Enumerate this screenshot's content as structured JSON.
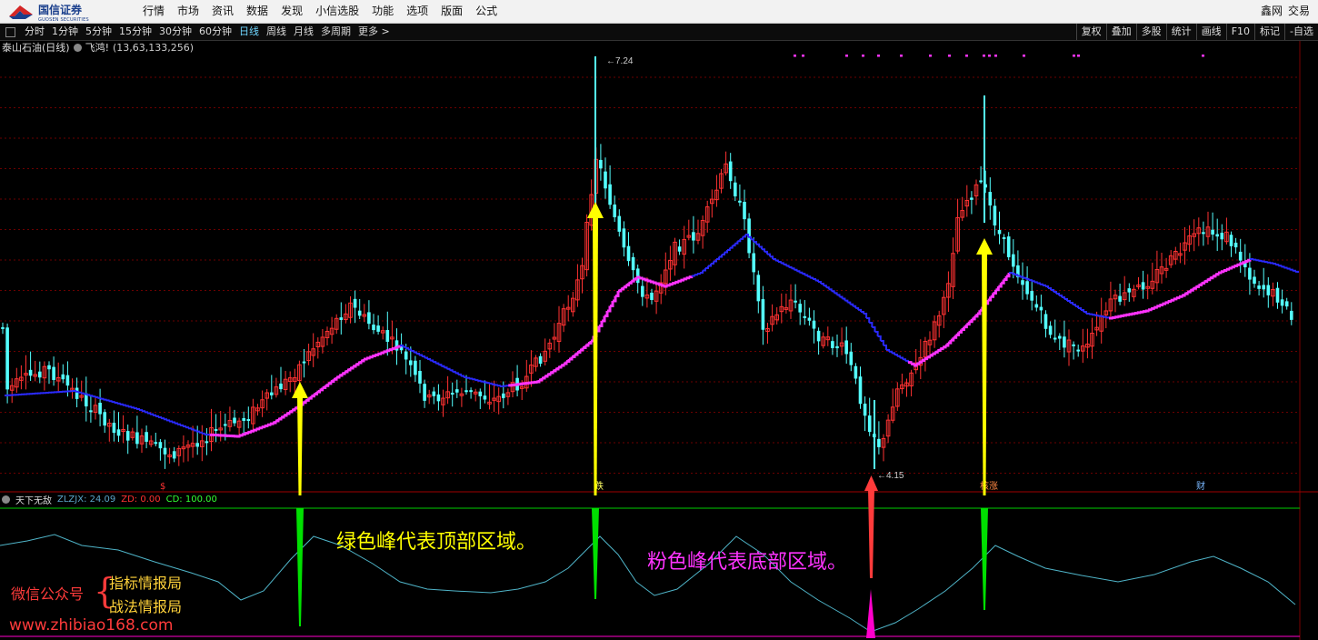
{
  "app": {
    "logo_name": "国信证券",
    "logo_sub": "GUOSEN SECURITIES"
  },
  "menu": [
    "行情",
    "市场",
    "资讯",
    "数据",
    "发现",
    "小信选股",
    "功能",
    "选项",
    "版面",
    "公式"
  ],
  "menu_right": [
    "鑫网",
    "交易"
  ],
  "periods": [
    "分时",
    "1分钟",
    "5分钟",
    "15分钟",
    "30分钟",
    "60分钟",
    "日线",
    "周线",
    "月线",
    "多周期",
    "更多 >"
  ],
  "active_period": "日线",
  "tools": [
    "复权",
    "叠加",
    "多股",
    "统计",
    "画线",
    "F10",
    "标记",
    "-自选"
  ],
  "stock": {
    "name": "泰山石油(日线)",
    "indicator": "飞鸿!",
    "params": "(13,63,133,256)"
  },
  "price_labels": {
    "high": "7.24",
    "low": "4.15"
  },
  "event_markers": [
    "$",
    "跌",
    "核涨",
    "财"
  ],
  "indicator2": {
    "name": "天下无敌",
    "zlzjx": "ZLZJX: 24.09",
    "zd": "ZD: 0.00",
    "cd": "CD: 100.00"
  },
  "annotations": {
    "green": "绿色峰代表顶部区域。",
    "pink": "粉色峰代表底部区域。"
  },
  "watermark": {
    "wechat": "微信公众号",
    "name1": "指标情报局",
    "name2": "战法情报局",
    "url": "www.zhibiao168.com"
  },
  "colors": {
    "up": "#ff3232",
    "down": "#54ffff",
    "pink_ma": "#ff33ff",
    "blue_ma": "#2a2aff",
    "arrow_yellow": "#ffff00",
    "arrow_red": "#ff3b3b",
    "green_peak": "#00e000",
    "pink_peak": "#ff00cc",
    "grid": "#6b0000",
    "cd_line": "#00cc00"
  }
}
